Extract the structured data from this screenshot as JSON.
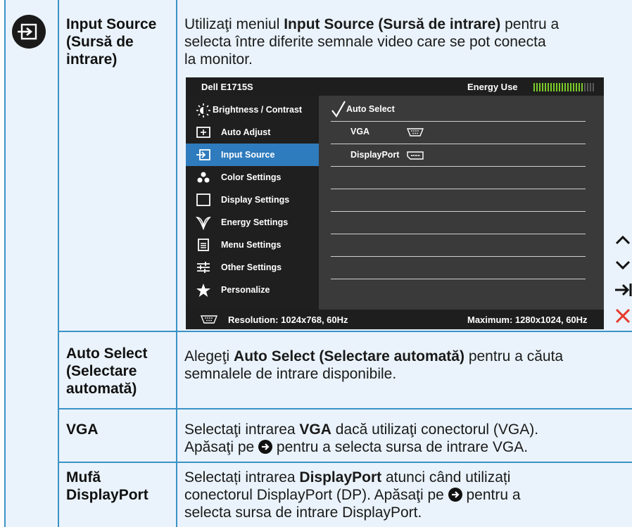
{
  "rows": [
    {
      "term": [
        "Input Source",
        "(Sursă de",
        "intrare)"
      ],
      "desc": [
        [
          "Utilizaţi meniul ",
          "Input Source (Sursă de intrare)",
          " pentru a"
        ],
        [
          "selecta între diferite semnale video care se pot conecta"
        ],
        [
          "la monitor."
        ]
      ]
    },
    {
      "term": [
        "Auto Select",
        "(Selectare",
        "automată)"
      ],
      "desc": [
        [
          "Alegeţi ",
          "Auto Select (Selectare automată)",
          " pentru a căuta"
        ],
        [
          "semnalele de intrare disponibile."
        ]
      ]
    },
    {
      "term": [
        "VGA"
      ],
      "desc": [
        [
          "Selectaţi intrarea ",
          "VGA",
          " dacă utilizaţi conectorul (VGA)."
        ],
        [
          "Apăsaţi pe ",
          "",
          " pentru a selecta sursa de intrare VGA."
        ]
      ]
    },
    {
      "term": [
        "Mufă",
        "DisplayPort"
      ],
      "desc": [
        [
          "Selectați intrarea ",
          "DisplayPort",
          " atunci când utilizați"
        ],
        [
          "conectorul DisplayPort (DP). Apăsaţi pe ",
          "",
          " pentru a"
        ],
        [
          "selecta sursa de intrare DisplayPort."
        ]
      ]
    }
  ],
  "osd": {
    "model": "Dell E1715S",
    "energy_label": "Energy Use",
    "menu_items": [
      "Brightness / Contrast",
      "Auto Adjust",
      "Input Source",
      "Color Settings",
      "Display Settings",
      "Energy Settings",
      "Menu Settings",
      "Other Settings",
      "Personalize"
    ],
    "selected_item": "Input Source",
    "sub_items": [
      "Auto Select",
      "VGA",
      "DisplayPort"
    ],
    "checked_sub_item": "Auto Select",
    "resolution": "Resolution: 1024x768, 60Hz",
    "maximum": "Maximum: 1280x1024, 60Hz",
    "energy_level": 0.8
  },
  "side_buttons": [
    "up-arrow-icon",
    "down-arrow-icon",
    "enter-arrow-icon",
    "close-icon"
  ],
  "colors": {
    "border": "#3a93c6",
    "cell_bg": "#eaf3fb",
    "osd_select": "#2e7bbd",
    "energy_green": "#7ccc2a",
    "close_red": "#e53a2a"
  }
}
